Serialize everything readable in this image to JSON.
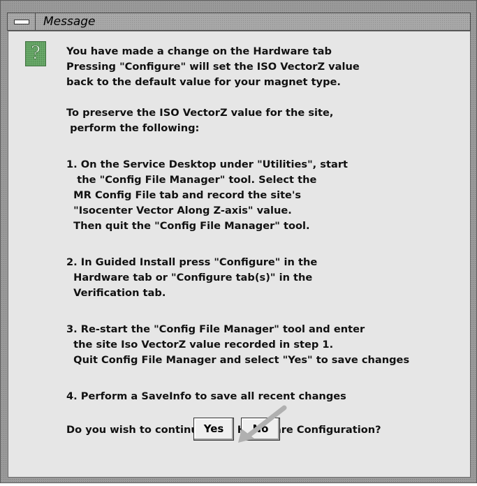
{
  "window": {
    "title": "Message"
  },
  "icons": {
    "menu": "window-menu-icon",
    "message": "question-icon",
    "question_glyph": "?"
  },
  "message": {
    "lines": [
      "You have made a change on the Hardware tab",
      "Pressing \"Configure\" will set the ISO VectorZ value",
      "back to the default value for your magnet type.",
      "",
      "To preserve the ISO VectorZ value for the site,",
      " perform the following:",
      "",
      "1. On the Service Desktop under \"Utilities\", start",
      "   the \"Config File Manager\" tool. Select the",
      "  MR Config File tab and record the site's",
      "  \"Isocenter Vector Along Z-axis\" value.",
      "  Then quit the \"Config File Manager\" tool.",
      "",
      "2. In Guided Install press \"Configure\" in the",
      "  Hardware tab or \"Configure tab(s)\" in the",
      "  Verification tab.",
      "",
      "3. Re-start the \"Config File Manager\" tool and enter",
      "  the site Iso VectorZ value recorded in step 1.",
      "  Quit Config File Manager and select \"Yes\" to save changes",
      "",
      "4. Perform a SaveInfo to save all recent changes",
      "",
      "Do you wish to continue with Hardware Configuration?"
    ]
  },
  "buttons": {
    "yes": "Yes",
    "no": "No"
  },
  "colors": {
    "icon_green": "#6aa86a",
    "dialog_bg": "#e6e6e6",
    "arrow": "#b0b0b0"
  }
}
